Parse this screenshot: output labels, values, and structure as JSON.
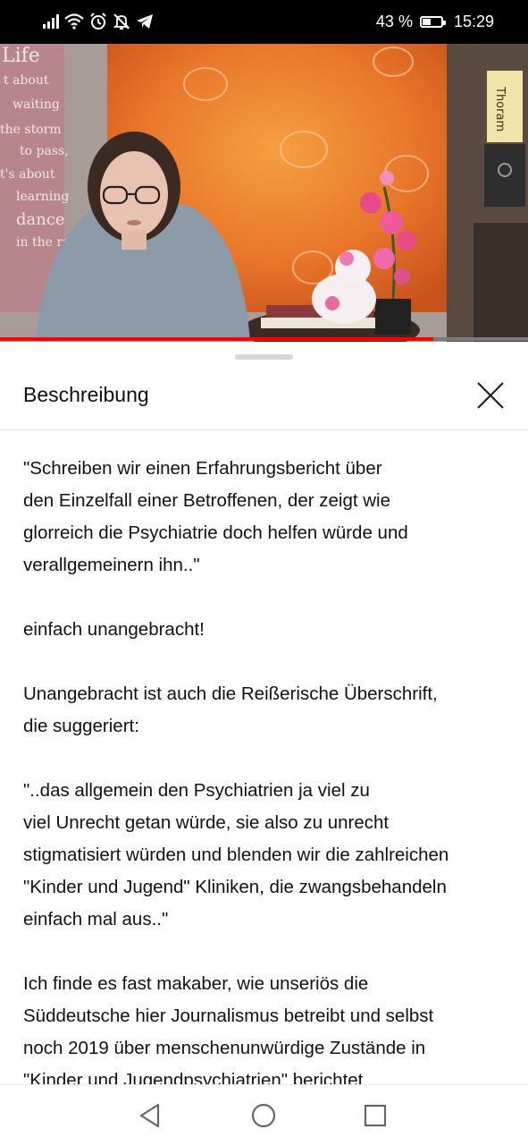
{
  "status_bar": {
    "icons": [
      "signal-icon",
      "wifi-icon",
      "alarm-icon",
      "notifications-off-icon",
      "telegram-icon"
    ],
    "battery_percent": "43 %",
    "battery_level": 0.43,
    "time": "15:29"
  },
  "video": {
    "poster_text": {
      "life": "Life",
      "line1": "t about",
      "line2": "waiting",
      "line3": "the storm",
      "line4": "to pass,",
      "line5": "t's about",
      "line6": "learning",
      "line7": "dance",
      "line8": "in the rain"
    },
    "binder_label": "Thoram",
    "progress": 0.82,
    "progress_color": "#ff0000"
  },
  "description_panel": {
    "title": "Beschreibung",
    "paragraphs": [
      {
        "lines": [
          "\"Schreiben wir einen Erfahrungsbericht über",
          "den Einzelfall einer Betroffenen, der zeigt wie",
          "glorreich die Psychiatrie doch helfen würde und",
          "verallgemeinern ihn..\""
        ]
      },
      {
        "lines": [
          "einfach unangebracht!"
        ]
      },
      {
        "lines": [
          "Unangebracht ist auch die Reißerische Überschrift,",
          "die suggeriert:"
        ]
      },
      {
        "lines": [
          "\"..das allgemein den Psychiatrien ja viel zu",
          "viel Unrecht getan würde, sie also zu unrecht",
          "stigmatisiert würden und blenden wir die zahlreichen",
          "\"Kinder und Jugend\" Kliniken, die zwangsbehandeln",
          "einfach mal aus..\""
        ]
      },
      {
        "lines": [
          "Ich finde es fast makaber, wie unseriös die",
          "Süddeutsche hier Journalismus betreibt und selbst",
          "noch 2019 über menschenunwürdige Zustände in",
          "\"Kinder und Jugendpsychiatrien\" berichtet"
        ]
      }
    ]
  },
  "nav_bar": {
    "buttons": [
      "back-icon",
      "home-icon",
      "recents-icon"
    ]
  }
}
